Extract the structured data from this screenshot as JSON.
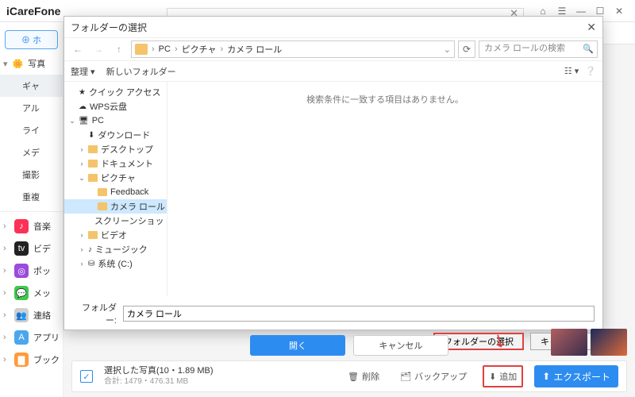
{
  "app": {
    "name": "iCareFone"
  },
  "sidebar": {
    "add_label": "⊕ ホ",
    "photo_section": "写真",
    "items": [
      "ギャ",
      "アル",
      "ライ",
      "メデ",
      "撮影",
      "重複"
    ],
    "cats": [
      {
        "icon": "♪",
        "bg": "#fc3158",
        "label": "音楽"
      },
      {
        "icon": "tv",
        "bg": "#222",
        "label": "ビデ"
      },
      {
        "icon": "◎",
        "bg": "#9a4cdc",
        "label": "ポッ"
      },
      {
        "icon": "💬",
        "bg": "#3fc950",
        "label": "メッ"
      },
      {
        "icon": "👥",
        "bg": "#cfcfcf",
        "label": "連絡"
      },
      {
        "icon": "A",
        "bg": "#4aa7ee",
        "label": "アプリ"
      },
      {
        "icon": "▇",
        "bg": "#ff9a3a",
        "label": "ブック"
      }
    ]
  },
  "dialog": {
    "title": "フォルダーの選択",
    "crumbs": [
      "PC",
      "ピクチャ",
      "カメラ ロール"
    ],
    "search_placeholder": "カメラ ロールの検索",
    "toolbar": {
      "organize": "整理 ▾",
      "newfolder": "新しいフォルダー"
    },
    "tree": [
      {
        "d": 0,
        "twist": "",
        "icon": "star",
        "label": "クイック アクセス"
      },
      {
        "d": 0,
        "twist": "",
        "icon": "cloud",
        "label": "WPS云盘"
      },
      {
        "d": 0,
        "twist": "v",
        "icon": "pc",
        "label": "PC"
      },
      {
        "d": 1,
        "twist": "",
        "icon": "dl",
        "label": "ダウンロード"
      },
      {
        "d": 1,
        "twist": ">",
        "icon": "fold",
        "label": "デスクトップ"
      },
      {
        "d": 1,
        "twist": ">",
        "icon": "fold",
        "label": "ドキュメント"
      },
      {
        "d": 1,
        "twist": "v",
        "icon": "fold",
        "label": "ピクチャ"
      },
      {
        "d": 2,
        "twist": "",
        "icon": "fold",
        "label": "Feedback"
      },
      {
        "d": 2,
        "twist": "",
        "icon": "fold",
        "label": "カメラ ロール",
        "sel": true
      },
      {
        "d": 2,
        "twist": "",
        "icon": "fold",
        "label": "スクリーンショット"
      },
      {
        "d": 1,
        "twist": ">",
        "icon": "fold",
        "label": "ビデオ"
      },
      {
        "d": 1,
        "twist": ">",
        "icon": "mus",
        "label": "ミュージック"
      },
      {
        "d": 1,
        "twist": ">",
        "icon": "drv",
        "label": "系统 (C:)"
      }
    ],
    "empty_msg": "検索条件に一致する項目はありません。",
    "folder_label": "フォルダー:",
    "folder_value": "カメラ ロール",
    "select_btn": "フォルダーの選択",
    "cancel_btn": "キャンセル"
  },
  "behind": {
    "open": "開く",
    "cancel": "キャンセル"
  },
  "status": {
    "title": "選択した写真(10・1.89 MB)",
    "subtitle": "合計: 1479・476.31 MB",
    "delete": "削除",
    "backup": "バックアップ",
    "add": "追加",
    "export": "エクスポート"
  }
}
